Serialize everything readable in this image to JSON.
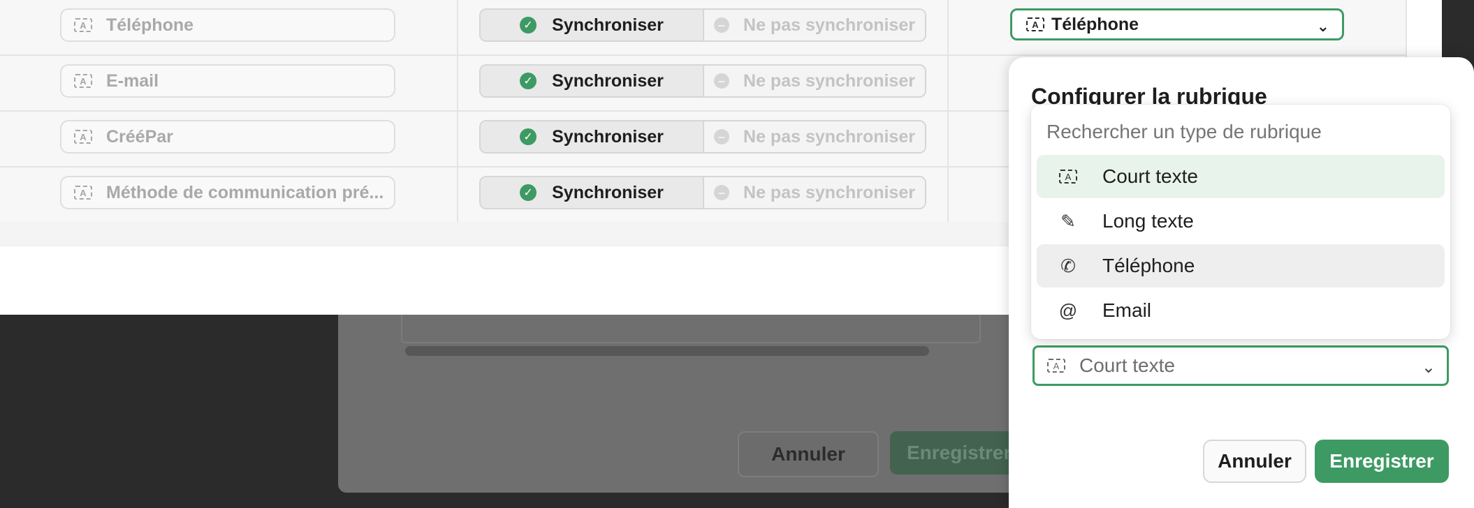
{
  "rows": [
    {
      "field": "Téléphone",
      "sync_on": "Synchroniser",
      "sync_off": "Ne pas synchroniser",
      "type": "Téléphone"
    },
    {
      "field": "E-mail",
      "sync_on": "Synchroniser",
      "sync_off": "Ne pas synchroniser"
    },
    {
      "field": "CrééPar",
      "sync_on": "Synchroniser",
      "sync_off": "Ne pas synchroniser"
    },
    {
      "field": "Méthode de communication pré...",
      "sync_on": "Synchroniser",
      "sync_off": "Ne pas synchroniser"
    }
  ],
  "background_modal": {
    "cancel": "Annuler",
    "save": "Enregistrer"
  },
  "panel": {
    "title": "Configurer la rubrique",
    "field_type_value": "Court texte",
    "cancel": "Annuler",
    "save": "Enregistrer"
  },
  "dropdown": {
    "search_placeholder": "Rechercher un type de rubrique",
    "options": [
      {
        "label": "Court texte",
        "icon": "short-text-icon",
        "state": "highlighted"
      },
      {
        "label": "Long texte",
        "icon": "edit-icon",
        "state": "normal"
      },
      {
        "label": "Téléphone",
        "icon": "phone-icon",
        "state": "selected"
      },
      {
        "label": "Email",
        "icon": "at-icon",
        "state": "normal"
      }
    ]
  },
  "colors": {
    "accent": "#3d9a63",
    "highlight": "#e8f3ec"
  }
}
